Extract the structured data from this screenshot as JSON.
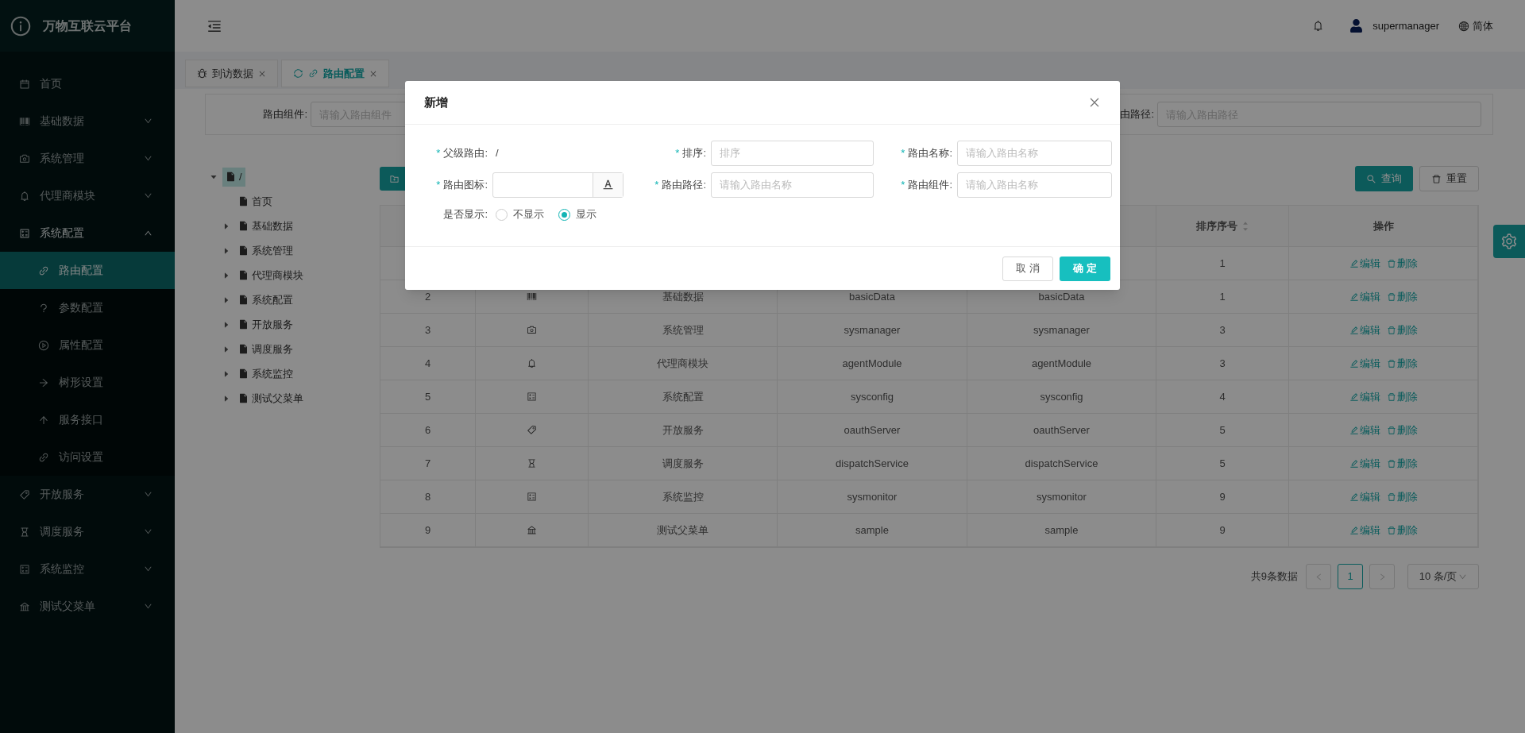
{
  "sidebar": {
    "title": "万物互联云平台",
    "items": [
      {
        "label": "首页",
        "kind": "link",
        "expanded": false
      },
      {
        "label": "基础数据",
        "kind": "menu",
        "expanded": false
      },
      {
        "label": "系统管理",
        "kind": "menu",
        "expanded": false
      },
      {
        "label": "代理商模块",
        "kind": "menu",
        "expanded": false
      },
      {
        "label": "系统配置",
        "kind": "menu",
        "expanded": true,
        "children": [
          {
            "label": "路由配置",
            "selected": true
          },
          {
            "label": "参数配置",
            "selected": false
          },
          {
            "label": "属性配置",
            "selected": false
          },
          {
            "label": "树形设置",
            "selected": false
          },
          {
            "label": "服务接口",
            "selected": false
          },
          {
            "label": "访问设置",
            "selected": false
          }
        ]
      },
      {
        "label": "开放服务",
        "kind": "menu",
        "expanded": false
      },
      {
        "label": "调度服务",
        "kind": "menu",
        "expanded": false
      },
      {
        "label": "系统监控",
        "kind": "menu",
        "expanded": false
      },
      {
        "label": "测试父菜单",
        "kind": "menu",
        "expanded": false
      }
    ]
  },
  "header": {
    "user": "supermanager",
    "language": "简体"
  },
  "tabs": [
    {
      "label": "到访数据",
      "selected": false
    },
    {
      "label": "路由配置",
      "selected": true
    }
  ],
  "search": {
    "fields": [
      {
        "label": "路由组件:",
        "placeholder": "请输入路由组件"
      },
      {
        "label": "由路径:",
        "placeholder": "请输入路由路径"
      }
    ],
    "buttons": [
      {
        "label": "查询",
        "kind": "primary"
      },
      {
        "label": "重置",
        "kind": "default"
      }
    ]
  },
  "tree": [
    {
      "label": "/",
      "selected": true,
      "expanded": true,
      "children": [
        {
          "label": "首页",
          "kind": "leaf",
          "selected": false
        },
        {
          "label": "基础数据",
          "kind": "branch",
          "selected": false,
          "expanded": false
        },
        {
          "label": "系统管理",
          "kind": "branch",
          "selected": false,
          "expanded": false
        },
        {
          "label": "代理商模块",
          "kind": "branch",
          "selected": false,
          "expanded": false
        },
        {
          "label": "系统配置",
          "kind": "branch",
          "selected": false,
          "expanded": false
        },
        {
          "label": "开放服务",
          "kind": "branch",
          "selected": false,
          "expanded": false
        },
        {
          "label": "调度服务",
          "kind": "branch",
          "selected": false,
          "expanded": false
        },
        {
          "label": "系统监控",
          "kind": "branch",
          "selected": false,
          "expanded": false
        },
        {
          "label": "测试父菜单",
          "kind": "branch",
          "selected": false,
          "expanded": false
        }
      ]
    }
  ],
  "table": {
    "columns": [
      {},
      {},
      {},
      {},
      {},
      {
        "label": "排序序号"
      },
      {
        "label": "操作"
      }
    ],
    "rows": [
      {
        "sort": "1",
        "actions": [
          "编辑",
          "删除"
        ]
      },
      {
        "index": "2",
        "name": "基础数据",
        "path": "basicData",
        "component": "basicData",
        "sort": "1",
        "actions": [
          "编辑",
          "删除"
        ]
      },
      {
        "index": "3",
        "name": "系统管理",
        "path": "sysmanager",
        "component": "sysmanager",
        "sort": "3",
        "actions": [
          "编辑",
          "删除"
        ]
      },
      {
        "index": "4",
        "name": "代理商模块",
        "path": "agentModule",
        "component": "agentModule",
        "sort": "3",
        "actions": [
          "编辑",
          "删除"
        ]
      },
      {
        "index": "5",
        "name": "系统配置",
        "path": "sysconfig",
        "component": "sysconfig",
        "sort": "4",
        "actions": [
          "编辑",
          "删除"
        ]
      },
      {
        "index": "6",
        "name": "开放服务",
        "path": "oauthServer",
        "component": "oauthServer",
        "sort": "5",
        "actions": [
          "编辑",
          "删除"
        ]
      },
      {
        "index": "7",
        "name": "调度服务",
        "path": "dispatchService",
        "component": "dispatchService",
        "sort": "5",
        "actions": [
          "编辑",
          "删除"
        ]
      },
      {
        "index": "8",
        "name": "系统监控",
        "path": "sysmonitor",
        "component": "sysmonitor",
        "sort": "9",
        "actions": [
          "编辑",
          "删除"
        ]
      },
      {
        "index": "9",
        "name": "测试父菜单",
        "path": "sample",
        "component": "sample",
        "sort": "9",
        "actions": [
          "编辑",
          "删除"
        ]
      }
    ]
  },
  "pagination": {
    "total": "共9条数据",
    "pages": [
      {
        "label": "1",
        "selected": true
      }
    ],
    "page_size": "10 条/页"
  },
  "dialog": {
    "title": "新增",
    "fields": [
      {
        "label": "父级路由:",
        "kind": "text",
        "required_mark": "*",
        "value": "/"
      },
      {
        "label": "排序:",
        "kind": "input",
        "required_mark": "*",
        "placeholder": "排序"
      },
      {
        "label": "路由名称:",
        "kind": "input",
        "required_mark": "*",
        "placeholder": "请输入路由名称"
      },
      {
        "label": "路由图标:",
        "kind": "icon",
        "required_mark": "*"
      },
      {
        "label": "路由路径:",
        "kind": "input",
        "required_mark": "*",
        "placeholder": "请输入路由名称"
      },
      {
        "label": "路由组件:",
        "kind": "input",
        "required_mark": "*",
        "placeholder": "请输入路由名称"
      },
      {
        "label": "是否显示:",
        "kind": "radio",
        "options": [
          {
            "label": "不显示",
            "selected": false
          },
          {
            "label": "显示",
            "selected": true
          }
        ]
      }
    ],
    "buttons": [
      {
        "label": "取 消",
        "kind": "default"
      },
      {
        "label": "确 定",
        "kind": "primary"
      }
    ]
  }
}
